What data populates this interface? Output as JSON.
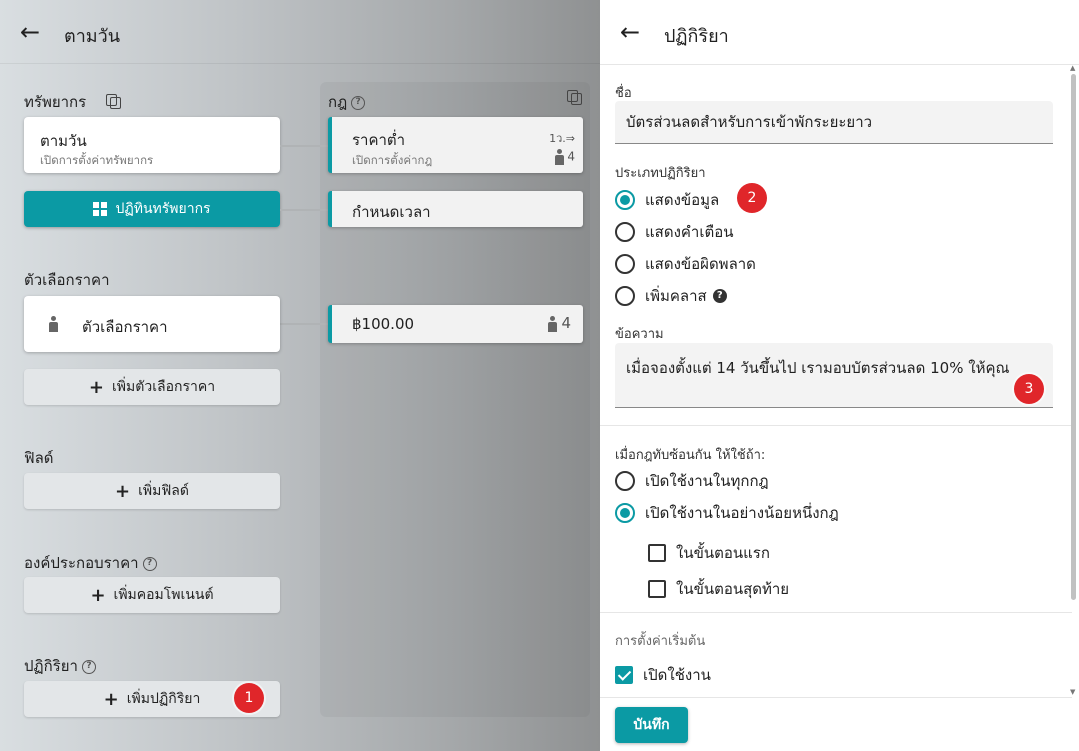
{
  "left": {
    "title": "ตามวัน",
    "resources": {
      "heading": "ทรัพยากร",
      "card_title": "ตามวัน",
      "card_sub": "เปิดการตั้งค่าทรัพยากร",
      "calendar_button": "ปฏิทินทรัพยากร"
    },
    "rules": {
      "heading": "กฎ",
      "rule1_title": "ราคาต่ำ",
      "rule1_sub": "เปิดการตั้งค่ากฎ",
      "rule1_meta": "1ว.⇒",
      "rule1_count": "4",
      "rule2_title": "กำหนดเวลา",
      "rule3_title": "฿100.00",
      "rule3_count": "4"
    },
    "price_options": {
      "heading": "ตัวเลือกราคา",
      "card_title": "ตัวเลือกราคา",
      "add_label": "เพิ่มตัวเลือกราคา"
    },
    "fields": {
      "heading": "ฟิลด์",
      "add_label": "เพิ่มฟิลด์"
    },
    "price_components": {
      "heading": "องค์ประกอบราคา",
      "add_label": "เพิ่มคอมโพเนนต์"
    },
    "actions": {
      "heading": "ปฏิกิริยา",
      "add_label": "เพิ่มปฏิกิริยา",
      "badge": "1"
    }
  },
  "right": {
    "title": "ปฏิกิริยา",
    "name_label": "ชื่อ",
    "name_value": "บัตรส่วนลดสำหรับการเข้าพักระยะยาว",
    "type_label": "ประเภทปฏิกิริยา",
    "type_options": [
      "แสดงข้อมูล",
      "แสดงคำเตือน",
      "แสดงข้อผิดพลาด",
      "เพิ่มคลาส"
    ],
    "type_selected": 0,
    "badge2": "2",
    "message_label": "ข้อความ",
    "message_value": "เมื่อจองตั้งแต่ 14 วันขึ้นไป เรามอบบัตรส่วนลด 10% ให้คุณ",
    "badge3": "3",
    "overlap_label": "เมื่อกฎทับซ้อนกัน ให้ใช้ถ้า:",
    "overlap_options": [
      "เปิดใช้งานในทุกกฎ",
      "เปิดใช้งานในอย่างน้อยหนึ่งกฎ"
    ],
    "overlap_selected": 1,
    "step_options": [
      "ในขั้นตอนแรก",
      "ในขั้นตอนสุดท้าย"
    ],
    "defaults_label": "การตั้งค่าเริ่มต้น",
    "enabled_label": "เปิดใช้งาน",
    "enabled": true,
    "save_label": "บันทึก"
  },
  "colors": {
    "accent": "#0b9aa4",
    "badge": "#e0262a"
  }
}
